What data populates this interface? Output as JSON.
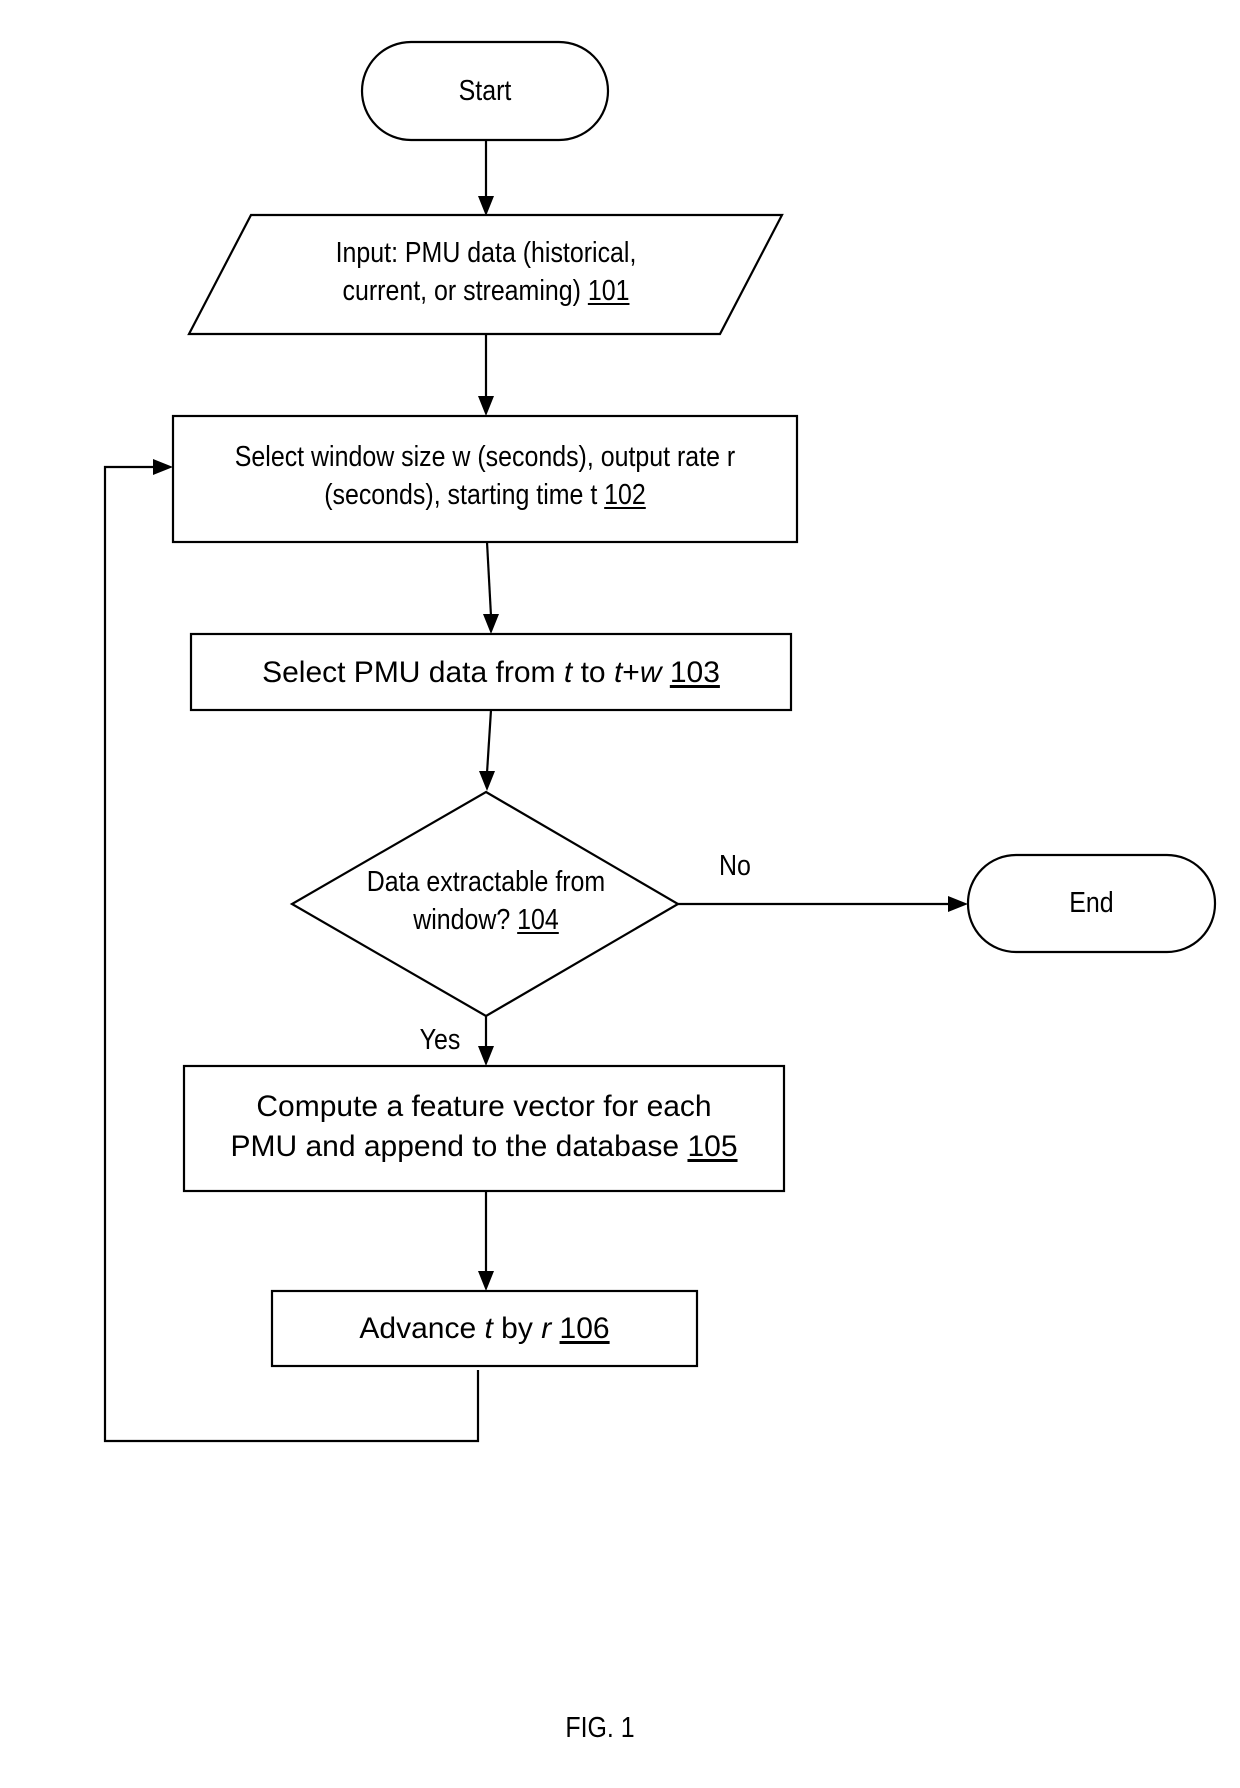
{
  "figure": {
    "caption": "FIG. 1",
    "nodes": {
      "start": {
        "text": "Start"
      },
      "input_101": {
        "line1": "Input: PMU data (historical,",
        "line2": "current, or streaming)",
        "ref": "101"
      },
      "step_102": {
        "line1": "Select window size w (seconds), output rate r",
        "line2": "(seconds), starting time t",
        "ref": "102"
      },
      "step_103": {
        "pre": "Select PMU data from",
        "var1": "t",
        "mid": "to",
        "var2": "t",
        "plus": "+",
        "var3": "w",
        "ref": "103"
      },
      "decision_104": {
        "line1": "Data extractable from",
        "line2": "window?",
        "ref": "104"
      },
      "step_105": {
        "line1": "Compute a feature vector for each",
        "line2": "PMU and append to the database",
        "ref": "105"
      },
      "step_106": {
        "pre": "Advance",
        "var1": "t",
        "mid": "by",
        "var2": "r",
        "ref": "106"
      },
      "end": {
        "text": "End"
      }
    },
    "edges": {
      "no_label": "No",
      "yes_label": "Yes"
    }
  }
}
